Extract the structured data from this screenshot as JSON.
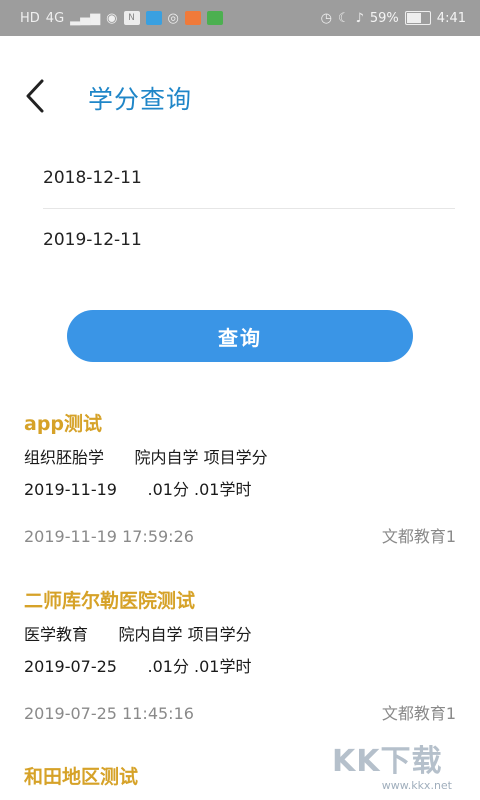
{
  "status_bar": {
    "left_text": "HD",
    "signal_text": "4G",
    "battery_text": "59%",
    "time": "4:41",
    "battery_level": 0.59
  },
  "header": {
    "title": "学分查询"
  },
  "form": {
    "start_date": "2018-12-11",
    "end_date": "2019-12-11",
    "query_label": "查询"
  },
  "records": [
    {
      "title": "app测试",
      "course": "组织胚胎学",
      "category": "院内自学 项目学分",
      "date": "2019-11-19",
      "credits": ".01分 .01学时",
      "timestamp": "2019-11-19 17:59:26",
      "org": "文都教育1"
    },
    {
      "title": "二师库尔勒医院测试",
      "course": "医学教育",
      "category": "院内自学 项目学分",
      "date": "2019-07-25",
      "credits": ".01分 .01学时",
      "timestamp": "2019-07-25 11:45:16",
      "org": "文都教育1"
    },
    {
      "title": "和田地区测试"
    }
  ],
  "colors": {
    "title_blue": "#1f86c8",
    "button_blue": "#3a95e6",
    "record_title_gold": "#d6a228",
    "muted_gray": "#8a8a8a",
    "status_bar_gray": "#9d9d9d"
  }
}
